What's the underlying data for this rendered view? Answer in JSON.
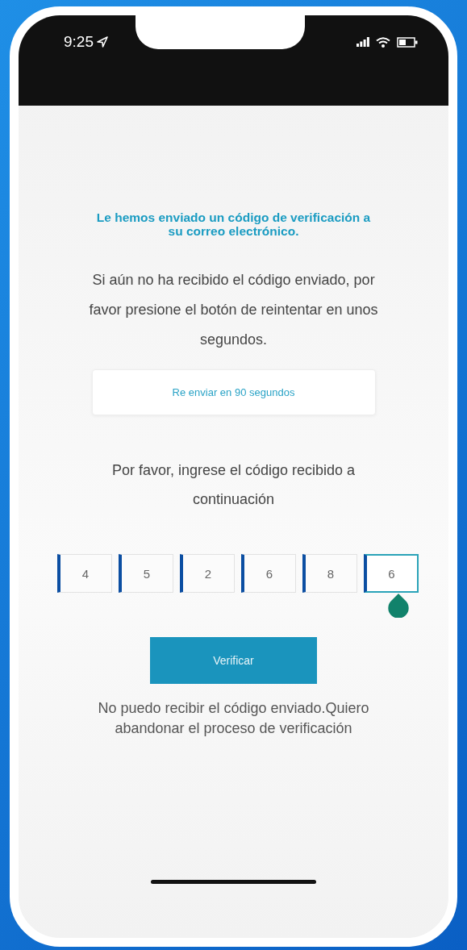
{
  "status_bar": {
    "time": "9:25"
  },
  "heading": "Le hemos enviado un código de verificación a su correo electrónico.",
  "message": "Si aún no ha recibido el código enviado, por favor presione el botón de reintentar en unos segundos.",
  "resend_button": {
    "label": "Re enviar en 90 segundos"
  },
  "instruction": "Por favor, ingrese el código recibido a continuación",
  "code_digits": [
    {
      "value": "4",
      "selected": false
    },
    {
      "value": "5",
      "selected": false
    },
    {
      "value": "2",
      "selected": false
    },
    {
      "value": "6",
      "selected": false
    },
    {
      "value": "8",
      "selected": false
    },
    {
      "value": "6",
      "selected": true
    }
  ],
  "verify_button": {
    "label": "Verificar"
  },
  "abandon_link": "No puedo recibir el código enviado.Quiero abandonar el proceso de verificación"
}
